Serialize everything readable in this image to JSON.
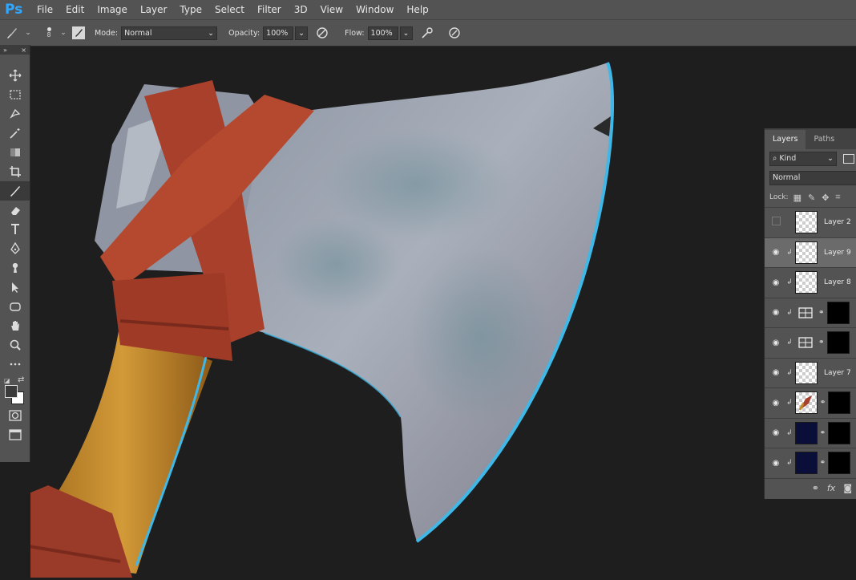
{
  "app": {
    "logo": "Ps"
  },
  "menu": [
    "File",
    "Edit",
    "Image",
    "Layer",
    "Type",
    "Select",
    "Filter",
    "3D",
    "View",
    "Window",
    "Help"
  ],
  "options": {
    "brush_size": "8",
    "mode_label": "Mode:",
    "mode_value": "Normal",
    "opacity_label": "Opacity:",
    "opacity_value": "100%",
    "flow_label": "Flow:",
    "flow_value": "100%"
  },
  "tools": [
    "move-icon",
    "marquee-icon",
    "lasso-icon",
    "magic-wand-icon",
    "gradient-icon",
    "crop-icon",
    "brush-icon",
    "eraser-icon",
    "type-icon",
    "pen-icon",
    "smudge-icon",
    "path-select-icon",
    "shape-icon",
    "hand-icon",
    "zoom-icon",
    "more-icon"
  ],
  "layers_panel": {
    "tabs": [
      "Layers",
      "Paths"
    ],
    "filter_label": "Kind",
    "blend_mode": "Normal",
    "lock_label": "Lock:",
    "layers": [
      {
        "name": "Layer 2",
        "visible": false,
        "clipped": false,
        "thumb": "checker",
        "mask": false
      },
      {
        "name": "Layer 9",
        "visible": true,
        "clipped": true,
        "thumb": "checker",
        "mask": false,
        "selected": true
      },
      {
        "name": "Layer 8",
        "visible": true,
        "clipped": true,
        "thumb": "checker",
        "mask": false
      },
      {
        "name": "",
        "visible": true,
        "clipped": true,
        "thumb": "adjust",
        "mask": true
      },
      {
        "name": "",
        "visible": true,
        "clipped": true,
        "thumb": "adjust",
        "mask": true
      },
      {
        "name": "Layer 7",
        "visible": true,
        "clipped": true,
        "thumb": "checker",
        "mask": false
      },
      {
        "name": "",
        "visible": true,
        "clipped": true,
        "thumb": "art",
        "mask": true
      },
      {
        "name": "",
        "visible": true,
        "clipped": true,
        "thumb": "navy",
        "mask": true
      },
      {
        "name": "",
        "visible": true,
        "clipped": true,
        "thumb": "navy",
        "mask": true
      }
    ],
    "footer": [
      "link-icon",
      "fx-icon",
      "mask-icon"
    ]
  },
  "colors": {
    "accent_blue": "#31a8ff",
    "rim_light": "#3fb8e8",
    "strap": "#a8402b",
    "handle": "#c08a2a",
    "blade": "#9aa3b0"
  }
}
